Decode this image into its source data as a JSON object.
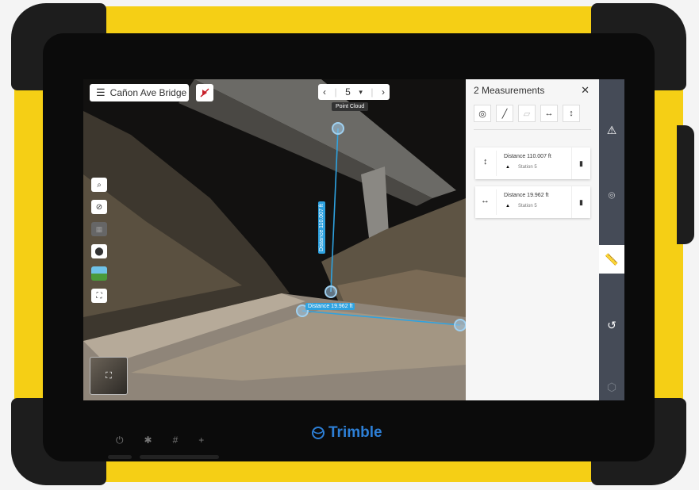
{
  "toolbar": {
    "project_name": "Cañon Ave Bridge",
    "station_number": "5",
    "station_dropdown": "▾",
    "prev_arrow": "‹",
    "next_arrow": "›",
    "view_mode": "Point Cloud"
  },
  "measurements_panel": {
    "title": "2 Measurements",
    "close": "✕",
    "items": [
      {
        "label": "Distance 110.007 ft",
        "station": "Station 5",
        "type_icon": "vertical-distance-icon"
      },
      {
        "label": "Distance 19.962 ft",
        "station": "Station 5",
        "type_icon": "horizontal-distance-icon"
      }
    ]
  },
  "scene": {
    "vertical_label": "Distance 110.007 ft",
    "horizontal_label": "Distance 19.962 ft"
  },
  "device": {
    "brand": "Trimble",
    "buttons": [
      "⏻",
      "✱",
      "#",
      "+"
    ]
  },
  "colors": {
    "body_yellow": "#f5cf15",
    "measure_blue": "#2ea2e0",
    "rail_gray": "#454b57"
  }
}
